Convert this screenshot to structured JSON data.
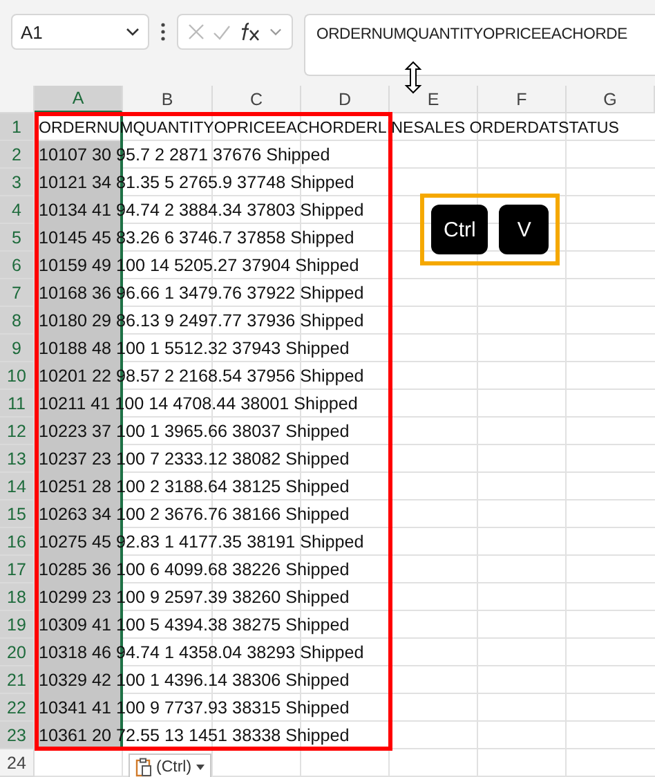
{
  "name_box": {
    "value": "A1"
  },
  "formula_bar": {
    "value": "ORDERNUMQUANTITYOPRICEEACHORDE"
  },
  "columns": [
    {
      "label": "A",
      "selected": true
    },
    {
      "label": "B",
      "selected": false
    },
    {
      "label": "C",
      "selected": false
    },
    {
      "label": "D",
      "selected": false
    },
    {
      "label": "E",
      "selected": false
    },
    {
      "label": "F",
      "selected": false
    },
    {
      "label": "G",
      "selected": false
    }
  ],
  "rows": [
    {
      "number": "1",
      "text": "ORDERNUMQUANTITYOPRICEEACHORDERLINESALES ORDERDATSTATUS"
    },
    {
      "number": "2",
      "text": "10107 30 95.7 2 2871 37676 Shipped"
    },
    {
      "number": "3",
      "text": "10121 34 81.35 5 2765.9 37748 Shipped"
    },
    {
      "number": "4",
      "text": "10134 41 94.74 2 3884.34 37803 Shipped"
    },
    {
      "number": "5",
      "text": "10145 45 83.26 6 3746.7 37858 Shipped"
    },
    {
      "number": "6",
      "text": "10159 49 100 14 5205.27 37904 Shipped"
    },
    {
      "number": "7",
      "text": "10168 36 96.66 1 3479.76 37922 Shipped"
    },
    {
      "number": "8",
      "text": "10180 29 86.13 9 2497.77 37936 Shipped"
    },
    {
      "number": "9",
      "text": "10188 48 100 1 5512.32 37943 Shipped"
    },
    {
      "number": "10",
      "text": "10201 22 98.57 2 2168.54 37956 Shipped"
    },
    {
      "number": "11",
      "text": "10211 41 100 14 4708.44 38001 Shipped"
    },
    {
      "number": "12",
      "text": "10223 37 100 1 3965.66 38037 Shipped"
    },
    {
      "number": "13",
      "text": "10237 23 100 7 2333.12 38082 Shipped"
    },
    {
      "number": "14",
      "text": "10251 28 100 2 3188.64 38125 Shipped"
    },
    {
      "number": "15",
      "text": "10263 34 100 2 3676.76 38166 Shipped"
    },
    {
      "number": "16",
      "text": "10275 45 92.83 1 4177.35 38191 Shipped"
    },
    {
      "number": "17",
      "text": "10285 36 100 6 4099.68 38226 Shipped"
    },
    {
      "number": "18",
      "text": "10299 23 100 9 2597.39 38260 Shipped"
    },
    {
      "number": "19",
      "text": "10309 41 100 5 4394.38 38275 Shipped"
    },
    {
      "number": "20",
      "text": "10318 46 94.74 1 4358.04 38293 Shipped"
    },
    {
      "number": "21",
      "text": "10329 42 100 1 4396.14 38306 Shipped"
    },
    {
      "number": "22",
      "text": "10341 41 100 9 7737.93 38315 Shipped"
    },
    {
      "number": "23",
      "text": "10361 20 72.55 13 1451 38338 Shipped"
    },
    {
      "number": "24"
    }
  ],
  "paste_options": {
    "label": "(Ctrl)"
  },
  "keys": [
    "Ctrl",
    "V"
  ]
}
